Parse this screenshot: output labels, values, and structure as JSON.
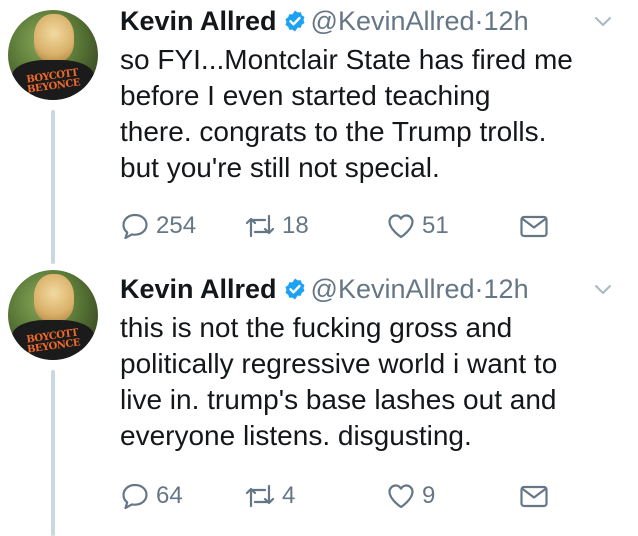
{
  "colors": {
    "text": "#14171a",
    "secondary": "#657786",
    "verified": "#1da1f2",
    "thread_line": "#ccd6dd",
    "shirt_text": "#f06a2a"
  },
  "tweets": [
    {
      "author": {
        "display_name": "Kevin Allred",
        "handle": "@KevinAllred",
        "verified_icon": "verified-badge-icon",
        "avatar_text": [
          "BOYCOTT",
          "BEYONCE"
        ]
      },
      "separator": "·",
      "time": "12h",
      "text_lines": [
        "so FYI...Montclair State has fired me",
        "before I even started teaching",
        "there. congrats to the Trump trolls.",
        "but you're still not special."
      ],
      "actions": {
        "reply_count": "254",
        "retweet_count": "18",
        "like_count": "51"
      }
    },
    {
      "author": {
        "display_name": "Kevin Allred",
        "handle": "@KevinAllred",
        "verified_icon": "verified-badge-icon",
        "avatar_text": [
          "BOYCOTT",
          "BEYONCE"
        ]
      },
      "separator": "·",
      "time": "12h",
      "text_lines": [
        "this is not the fucking gross and",
        "politically regressive world i want to",
        "live in. trump's base lashes out and",
        "everyone listens. disgusting."
      ],
      "actions": {
        "reply_count": "64",
        "retweet_count": "4",
        "like_count": "9"
      }
    }
  ]
}
